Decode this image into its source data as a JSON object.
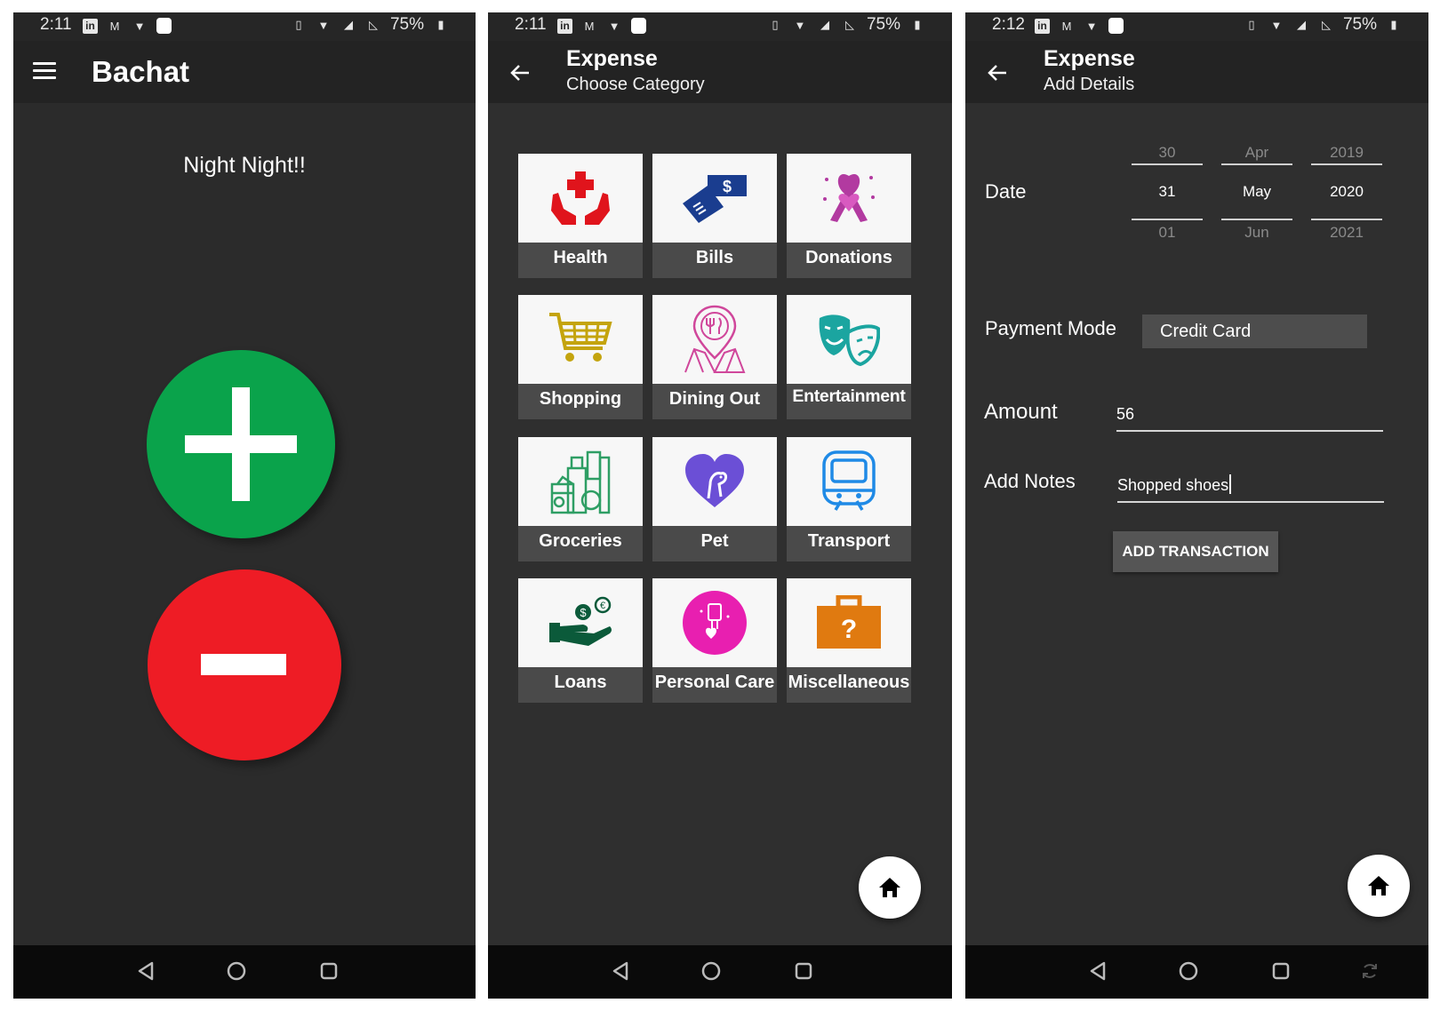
{
  "screens": [
    {
      "status": {
        "time": "2:11",
        "battery": "75%"
      },
      "appbar": {
        "title": "Bachat"
      },
      "greeting": "Night Night!!"
    },
    {
      "status": {
        "time": "2:11",
        "battery": "75%"
      },
      "appbar": {
        "title": "Expense",
        "subtitle": "Choose Category"
      },
      "categories": [
        {
          "label": "Health",
          "icon": "health-icon"
        },
        {
          "label": "Bills",
          "icon": "bills-icon"
        },
        {
          "label": "Donations",
          "icon": "donations-icon"
        },
        {
          "label": "Shopping",
          "icon": "shopping-cart-icon"
        },
        {
          "label": "Dining Out",
          "icon": "dining-out-icon"
        },
        {
          "label": "Entertainment",
          "icon": "theater-masks-icon"
        },
        {
          "label": "Groceries",
          "icon": "groceries-icon"
        },
        {
          "label": "Pet",
          "icon": "pet-icon"
        },
        {
          "label": "Transport",
          "icon": "train-icon"
        },
        {
          "label": "Loans",
          "icon": "loans-icon"
        },
        {
          "label": "Personal Care",
          "icon": "personal-care-icon"
        },
        {
          "label": "Miscellaneous",
          "icon": "miscellaneous-icon"
        }
      ]
    },
    {
      "status": {
        "time": "2:12",
        "battery": "75%"
      },
      "appbar": {
        "title": "Expense",
        "subtitle": "Add Details"
      },
      "form": {
        "date_label": "Date",
        "day": {
          "prev": "30",
          "current": "31",
          "next": "01"
        },
        "month": {
          "prev": "Apr",
          "current": "May",
          "next": "Jun"
        },
        "year": {
          "prev": "2019",
          "current": "2020",
          "next": "2021"
        },
        "payment_label": "Payment Mode",
        "payment_value": "Credit Card",
        "amount_label": "Amount",
        "amount_value": "56",
        "notes_label": "Add Notes",
        "notes_value": "Shopped shoes",
        "submit_label": "ADD TRANSACTION"
      }
    }
  ],
  "colors": {
    "add": "#0aa34b",
    "subtract": "#ee1c25",
    "appbar": "#232323",
    "background": "#2f2f2f"
  }
}
